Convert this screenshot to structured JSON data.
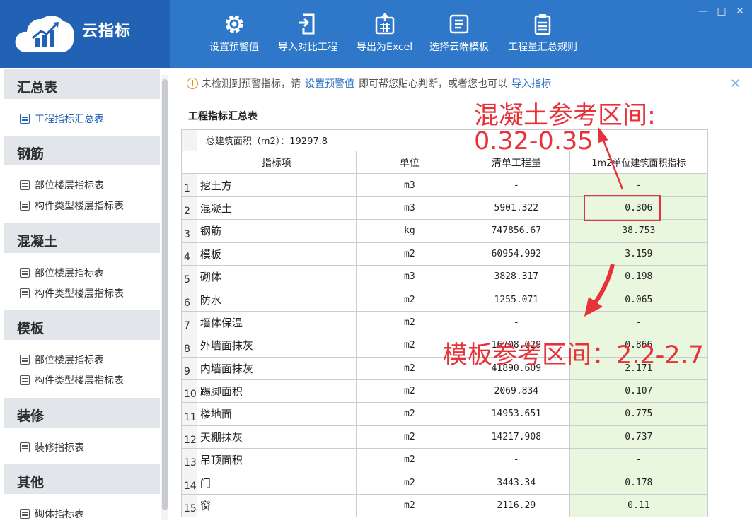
{
  "app": {
    "title": "云指标"
  },
  "toolbar": [
    {
      "label": "设置预警值",
      "icon": "gear-icon"
    },
    {
      "label": "导入对比工程",
      "icon": "import-icon"
    },
    {
      "label": "导出为Excel",
      "icon": "export-excel-icon"
    },
    {
      "label": "选择云端模板",
      "icon": "template-icon"
    },
    {
      "label": "工程量汇总规则",
      "icon": "clipboard-icon"
    }
  ],
  "window_controls": {
    "minimize": "—",
    "maximize": "□",
    "close": "✕"
  },
  "sidebar": {
    "groups": [
      {
        "title": "汇总表",
        "items": [
          "工程指标汇总表"
        ]
      },
      {
        "title": "钢筋",
        "items": [
          "部位楼层指标表",
          "构件类型楼层指标表"
        ]
      },
      {
        "title": "混凝土",
        "items": [
          "部位楼层指标表",
          "构件类型楼层指标表"
        ]
      },
      {
        "title": "模板",
        "items": [
          "部位楼层指标表",
          "构件类型楼层指标表"
        ]
      },
      {
        "title": "装修",
        "items": [
          "装修指标表"
        ]
      },
      {
        "title": "其他",
        "items": [
          "砌体指标表"
        ]
      }
    ]
  },
  "notice": {
    "icon": "warning-icon",
    "text1": "未检测到预警指标，请",
    "link1": "设置预警值",
    "text2": "即可帮您贴心判断，或者您也可以",
    "link2": "导入指标",
    "close": "✕"
  },
  "table": {
    "title": "工程指标汇总表",
    "area_label": "总建筑面积（m2）：19297.8",
    "headers": [
      "指标项",
      "单位",
      "清单工程量",
      "1m2单位建筑面积指标"
    ],
    "rows": [
      {
        "idx": "1",
        "name": "挖土方",
        "unit": "m3",
        "qty": "-",
        "ind": "-"
      },
      {
        "idx": "2",
        "name": "混凝土",
        "unit": "m3",
        "qty": "5901.322",
        "ind": "0.306"
      },
      {
        "idx": "3",
        "name": "钢筋",
        "unit": "kg",
        "qty": "747856.67",
        "ind": "38.753"
      },
      {
        "idx": "4",
        "name": "模板",
        "unit": "m2",
        "qty": "60954.992",
        "ind": "3.159"
      },
      {
        "idx": "5",
        "name": "砌体",
        "unit": "m3",
        "qty": "3828.317",
        "ind": "0.198"
      },
      {
        "idx": "6",
        "name": "防水",
        "unit": "m2",
        "qty": "1255.071",
        "ind": "0.065"
      },
      {
        "idx": "7",
        "name": "墙体保温",
        "unit": "m2",
        "qty": "-",
        "ind": "-"
      },
      {
        "idx": "8",
        "name": "外墙面抹灰",
        "unit": "m2",
        "qty": "16708.029",
        "ind": "0.866"
      },
      {
        "idx": "9",
        "name": "内墙面抹灰",
        "unit": "m2",
        "qty": "41890.609",
        "ind": "2.171"
      },
      {
        "idx": "10",
        "name": "踢脚面积",
        "unit": "m2",
        "qty": "2069.834",
        "ind": "0.107"
      },
      {
        "idx": "11",
        "name": "楼地面",
        "unit": "m2",
        "qty": "14953.651",
        "ind": "0.775"
      },
      {
        "idx": "12",
        "name": "天棚抹灰",
        "unit": "m2",
        "qty": "14217.908",
        "ind": "0.737"
      },
      {
        "idx": "13",
        "name": "吊顶面积",
        "unit": "m2",
        "qty": "-",
        "ind": "-"
      },
      {
        "idx": "14",
        "name": "门",
        "unit": "m2",
        "qty": "3443.34",
        "ind": "0.178"
      },
      {
        "idx": "15",
        "name": "窗",
        "unit": "m2",
        "qty": "2116.29",
        "ind": "0.11"
      }
    ]
  },
  "annotations": {
    "concrete_line1": "混凝土参考区间:",
    "concrete_line2": "0.32-0.35",
    "formwork": "模板参考区间：2.2-2.7",
    "color": "#e8323a"
  }
}
